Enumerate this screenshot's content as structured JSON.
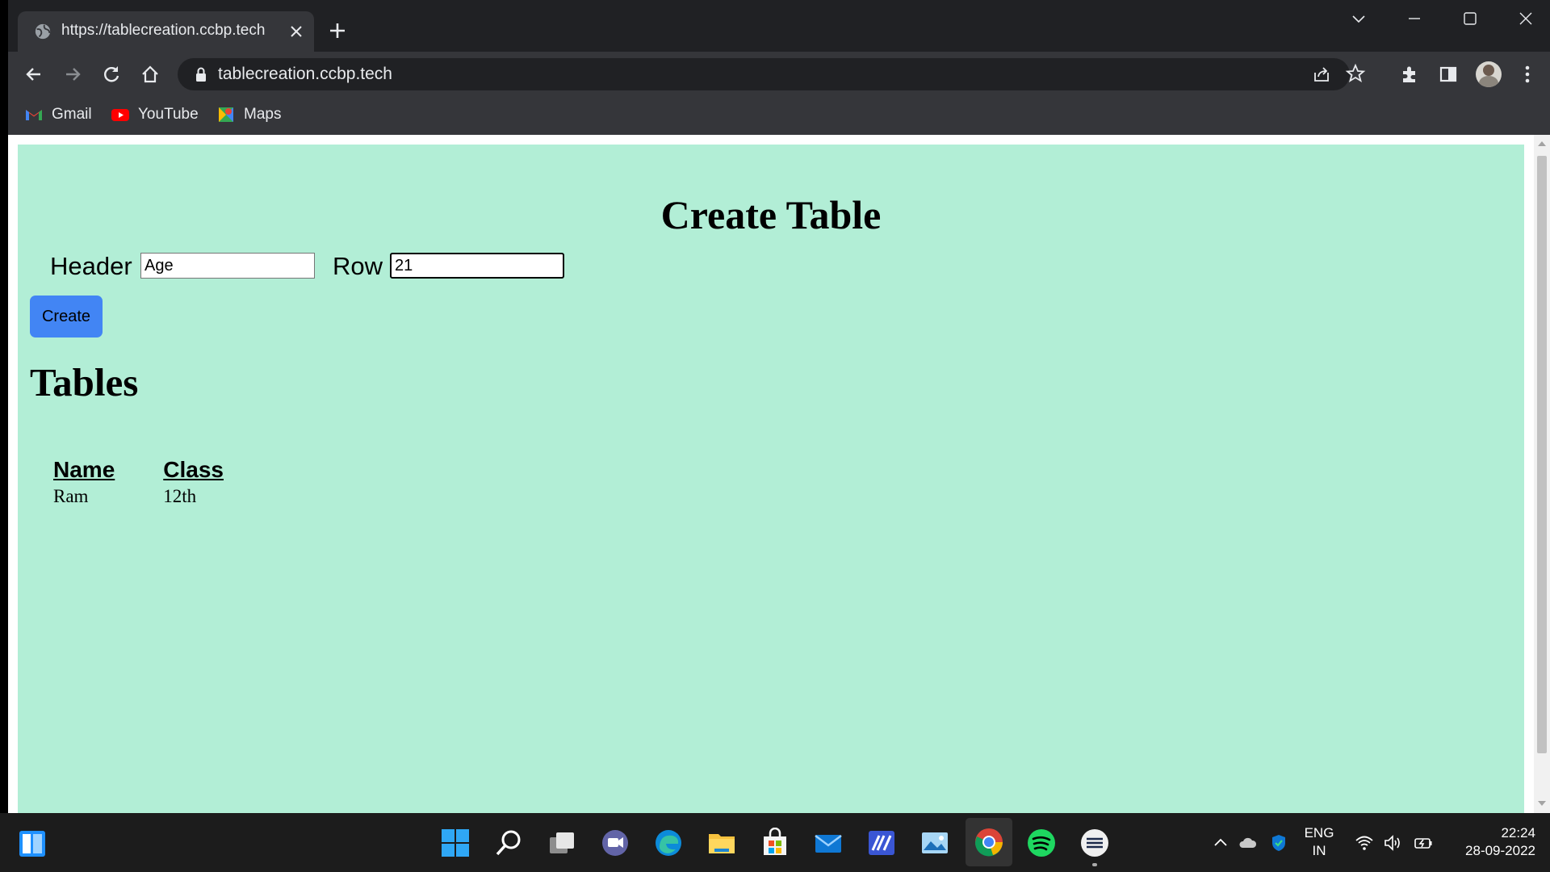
{
  "browser": {
    "tab_title": "https://tablecreation.ccbp.tech",
    "url": "tablecreation.ccbp.tech",
    "bookmarks": [
      "Gmail",
      "YouTube",
      "Maps"
    ]
  },
  "page": {
    "title": "Create Table",
    "header_label": "Header",
    "header_value": "Age",
    "row_label": "Row",
    "row_value": "21",
    "create_button": "Create",
    "tables_heading": "Tables",
    "table": {
      "headers": [
        "Name",
        "Class"
      ],
      "rows": [
        [
          "Ram",
          "12th"
        ]
      ]
    }
  },
  "taskbar": {
    "language": "ENG",
    "region": "IN",
    "time": "22:24",
    "date": "28-09-2022"
  },
  "colors": {
    "page_background": "#b2eed6",
    "button": "#4285f4",
    "chrome_dark": "#202124",
    "chrome_toolbar": "#35363a"
  }
}
